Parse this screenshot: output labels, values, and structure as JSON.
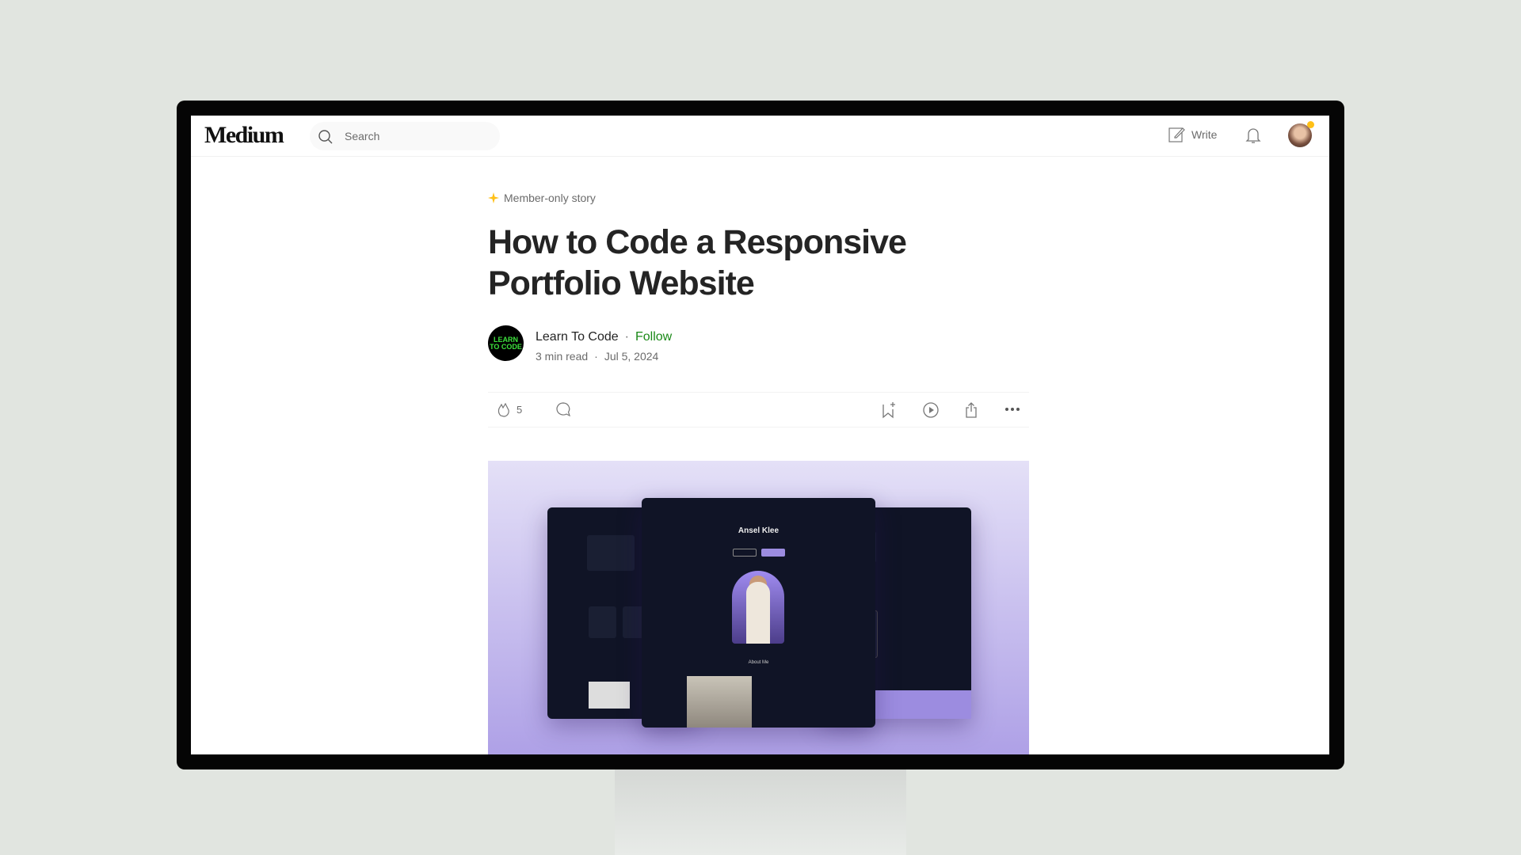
{
  "header": {
    "logo": "Medium",
    "search_placeholder": "Search",
    "write_label": "Write"
  },
  "article": {
    "badge": "Member-only story",
    "title": "How to Code a Responsive Portfolio Website",
    "author": {
      "name": "Learn To Code",
      "avatar_text": "LEARN TO CODE",
      "follow_label": "Follow"
    },
    "read_time": "3 min read",
    "date": "Jul 5, 2024",
    "claps": "5",
    "hero": {
      "name": "Ansel Klee",
      "section": "About Me"
    }
  },
  "colors": {
    "accent": "#1a8917",
    "member_star": "#ffc017",
    "hero_purple": "#ad9fe6"
  }
}
